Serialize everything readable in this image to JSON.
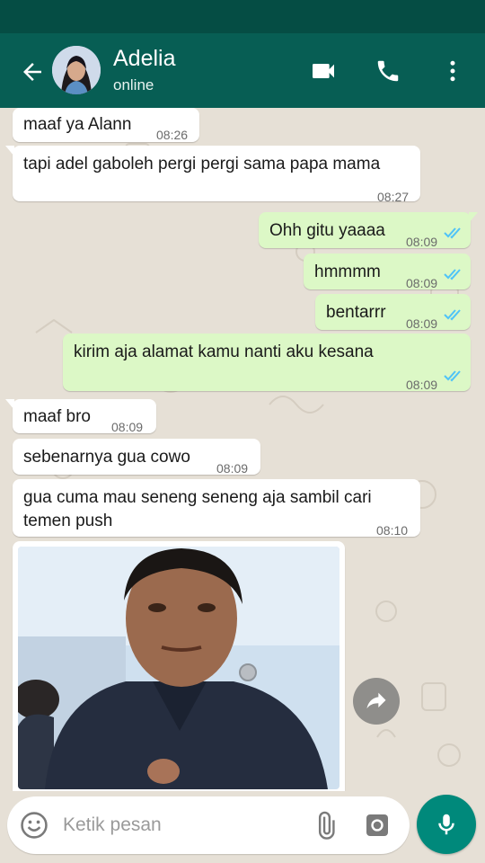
{
  "header": {
    "contact_name": "Adelia",
    "contact_status": "online",
    "icons": [
      "back-arrow-icon",
      "video-call-icon",
      "phone-icon",
      "more-vert-icon"
    ]
  },
  "messages": [
    {
      "direction": "in",
      "text": "maaf ya Alann",
      "time": "08:26"
    },
    {
      "direction": "in",
      "text": "tapi adel gaboleh pergi pergi sama papa mama",
      "time": "08:27"
    },
    {
      "direction": "out",
      "text": "Ohh gitu yaaaa",
      "time": "08:09",
      "status": "read"
    },
    {
      "direction": "out",
      "text": "hmmmm",
      "time": "08:09",
      "status": "read"
    },
    {
      "direction": "out",
      "text": "bentarrr",
      "time": "08:09",
      "status": "read"
    },
    {
      "direction": "out",
      "text": "kirim aja alamat kamu nanti aku kesana",
      "time": "08:09",
      "status": "read"
    },
    {
      "direction": "in",
      "text": "maaf bro",
      "time": "08:09"
    },
    {
      "direction": "in",
      "text": "sebenarnya gua cowo",
      "time": "08:09"
    },
    {
      "direction": "in",
      "text": "gua cuma mau seneng seneng aja sambil cari temen push",
      "time": "08:10"
    },
    {
      "direction": "in",
      "type": "image",
      "icon": "photo-message"
    }
  ],
  "composer": {
    "placeholder": "Ketik pesan",
    "value": "",
    "icons": [
      "emoji-icon",
      "attach-icon",
      "camera-icon",
      "mic-icon"
    ]
  },
  "colors": {
    "header": "#075e54",
    "status_bar": "#054d44",
    "outgoing_bubble": "#dcf8c6",
    "incoming_bubble": "#ffffff",
    "read_ticks": "#4fc3f7",
    "mic_button": "#00897b",
    "chat_background": "#e6e0d6"
  }
}
